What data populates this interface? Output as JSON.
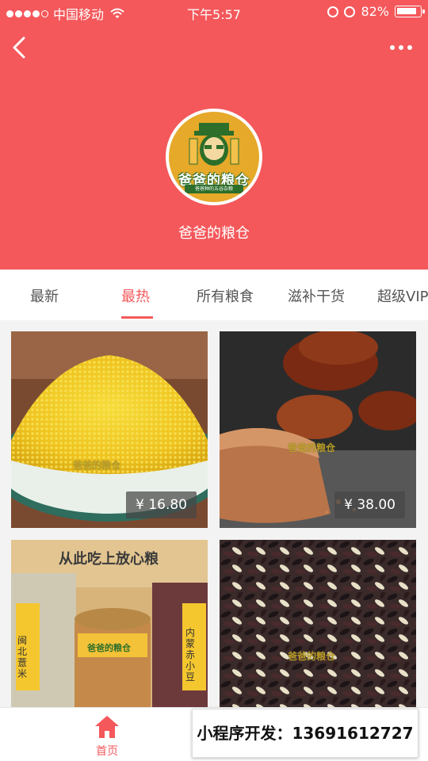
{
  "status_bar": {
    "carrier": "中国移动",
    "time": "下午5:57",
    "battery": "82%",
    "battery_level": 0.82
  },
  "shop": {
    "name": "爸爸的粮仓",
    "logo_text": "爸爸的粮仓",
    "logo_subtext": "爸爸种的五谷杂粮",
    "theme_color": "#f4585b"
  },
  "tabs": [
    {
      "label": "最新"
    },
    {
      "label": "最热",
      "active": true
    },
    {
      "label": "所有粮食"
    },
    {
      "label": "滋补干货"
    },
    {
      "label": "超级VIP"
    }
  ],
  "products": [
    {
      "price": "¥ 16.80",
      "watermark": "爸爸的粮仓"
    },
    {
      "price": "¥ 38.00",
      "watermark": "爸爸的粮仓"
    },
    {
      "banner_text": "从此吃上放心粮",
      "label_left": "闽北薏米",
      "label_right": "内蒙赤小豆",
      "jar_label": "爸爸的粮仓"
    },
    {
      "watermark": "爸爸的粮仓"
    }
  ],
  "bottom_nav": {
    "home_label": "首页"
  },
  "promo": {
    "text": "小程序开发：13691612727"
  }
}
